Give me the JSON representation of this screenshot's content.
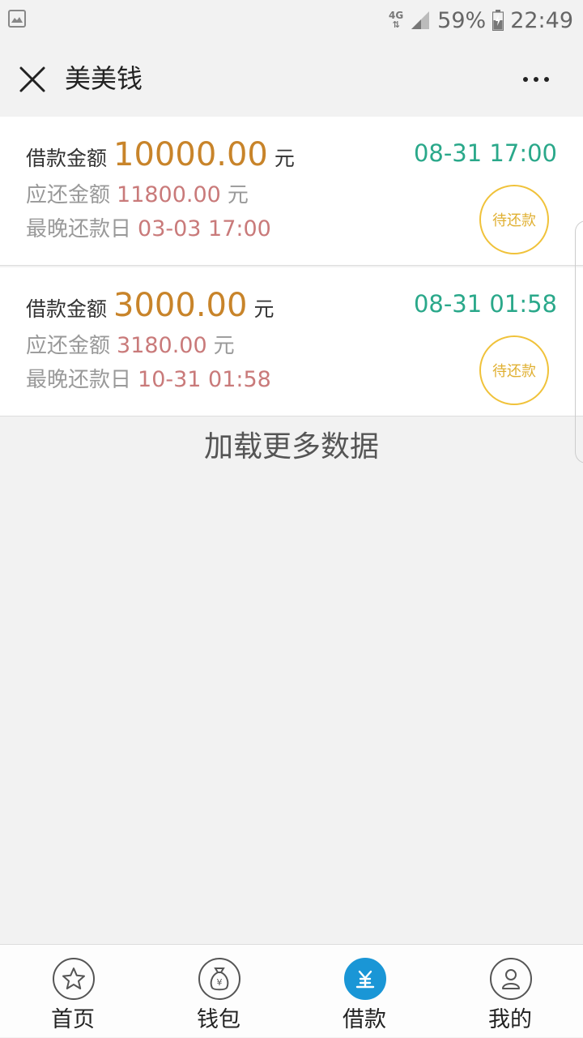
{
  "status_bar": {
    "network": "4G",
    "battery": "59%",
    "time": "22:49"
  },
  "header": {
    "title": "美美钱",
    "close_icon": "close-icon",
    "more_icon": "more-dots-icon"
  },
  "loans": [
    {
      "amount_label": "借款金额",
      "amount": "10000.00",
      "amount_unit": "元",
      "date": "08-31 17:00",
      "repay_label": "应还金额",
      "repay_amount": "11800.00",
      "repay_unit": "元",
      "due_label": "最晚还款日",
      "due_date": "03-03 17:00",
      "status": "待还款"
    },
    {
      "amount_label": "借款金额",
      "amount": "3000.00",
      "amount_unit": "元",
      "date": "08-31 01:58",
      "repay_label": "应还金额",
      "repay_amount": "3180.00",
      "repay_unit": "元",
      "due_label": "最晚还款日",
      "due_date": "10-31 01:58",
      "status": "待还款"
    }
  ],
  "load_more": "加载更多数据",
  "tabs": [
    {
      "label": "首页",
      "icon": "star-icon",
      "active": false
    },
    {
      "label": "钱包",
      "icon": "money-bag-icon",
      "active": false
    },
    {
      "label": "借款",
      "icon": "loan-yen-icon",
      "active": true
    },
    {
      "label": "我的",
      "icon": "user-icon",
      "active": false
    }
  ],
  "colors": {
    "amount": "#c8842a",
    "date": "#2aa88a",
    "repay": "#c97a7a",
    "status": "#f0c23a",
    "active_tab": "#1a96d6"
  }
}
